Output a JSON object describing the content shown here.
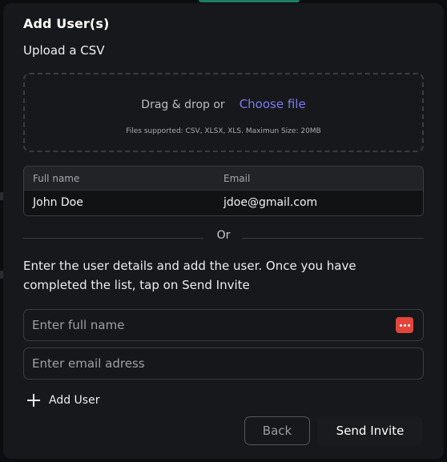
{
  "modal": {
    "title": "Add User(s)",
    "subtitle": "Upload a CSV"
  },
  "dropzone": {
    "text": "Drag & drop or",
    "link": "Choose file",
    "note": "Files supported: CSV, XLSX, XLS. Maximun Size: 20MB"
  },
  "table": {
    "headers": [
      "Full name",
      "Email"
    ],
    "rows": [
      [
        "John Doe",
        "jdoe@gmail.com"
      ]
    ]
  },
  "divider": {
    "label": "Or"
  },
  "instructions": "Enter the user details and add the user. Once you have completed the list, tap on Send Invite",
  "form": {
    "full_name": {
      "value": "",
      "placeholder": "Enter full name"
    },
    "email": {
      "value": "",
      "placeholder": "Enter email adress"
    },
    "password_manager_icon": "password-dots-icon"
  },
  "add_user_label": "Add User",
  "buttons": {
    "back": "Back",
    "send": "Send Invite"
  },
  "colors": {
    "accent_link": "#7d7bf0",
    "icon_red": "#e2453c",
    "background": "#17181b"
  }
}
